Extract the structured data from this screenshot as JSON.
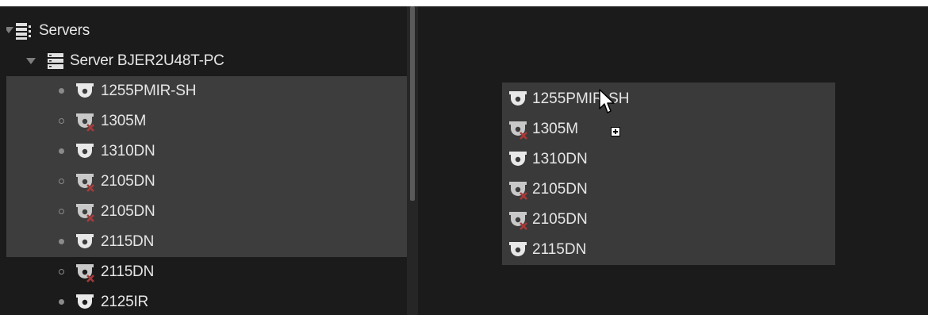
{
  "tree": {
    "root_label": "Servers",
    "server_label": "Server BJER2U48T-PC",
    "cameras": [
      {
        "label": "1255PMIR-SH",
        "online": true,
        "icon": "camera-icon"
      },
      {
        "label": "1305M",
        "online": false,
        "icon": "camera-offline-icon"
      },
      {
        "label": "1310DN",
        "online": true,
        "icon": "camera-icon"
      },
      {
        "label": "2105DN",
        "online": false,
        "icon": "camera-offline-icon"
      },
      {
        "label": "2105DN",
        "online": false,
        "icon": "camera-offline-icon"
      },
      {
        "label": "2115DN",
        "online": true,
        "icon": "camera-icon"
      },
      {
        "label": "2115DN",
        "online": false,
        "icon": "camera-offline-icon"
      },
      {
        "label": "2125IR",
        "online": true,
        "icon": "camera-icon"
      }
    ]
  },
  "drag_preview": {
    "items": [
      {
        "label": "1255PMIR-SH",
        "icon": "camera-icon"
      },
      {
        "label": "1305M",
        "icon": "camera-offline-icon"
      },
      {
        "label": "1310DN",
        "icon": "camera-icon"
      },
      {
        "label": "2105DN",
        "icon": "camera-offline-icon"
      },
      {
        "label": "2105DN",
        "icon": "camera-offline-icon"
      },
      {
        "label": "2115DN",
        "icon": "camera-icon"
      }
    ]
  },
  "colors": {
    "background": "#1b1b1b",
    "selection": "#3d3d3d",
    "drag_box": "#3a3a3a",
    "text": "#e6e6e6"
  }
}
